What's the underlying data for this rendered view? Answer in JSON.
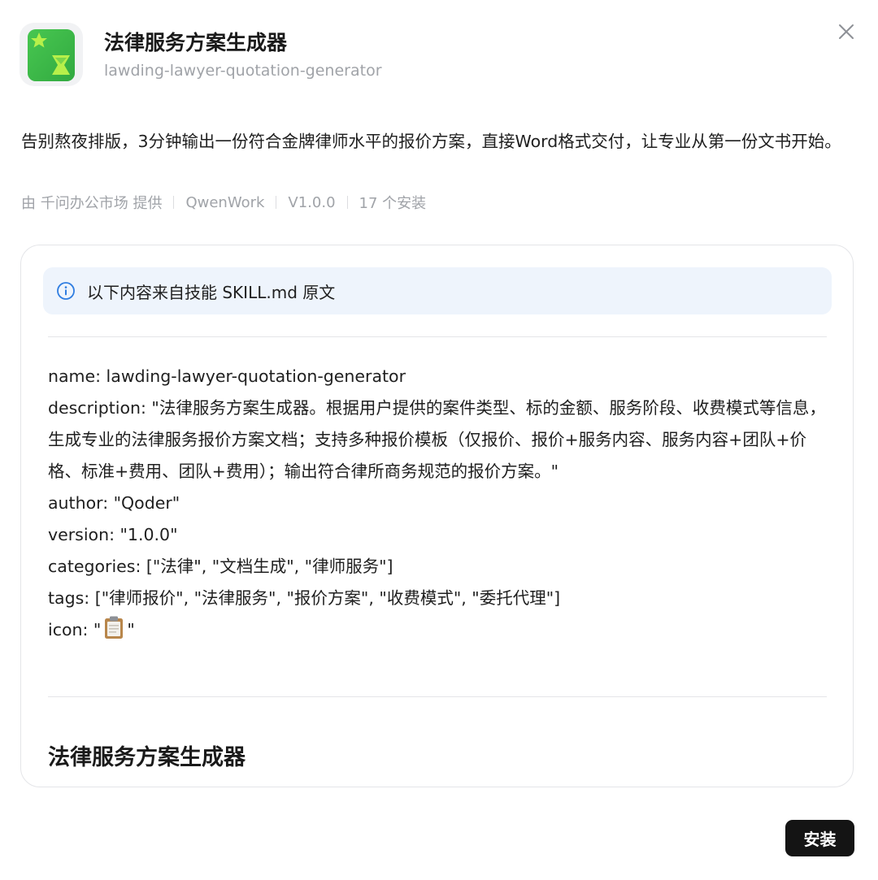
{
  "app": {
    "title": "法律服务方案生成器",
    "slug": "lawding-lawyer-quotation-generator",
    "icon": "app-icon-green-hourglass-star"
  },
  "summary": "告别熬夜排版，3分钟输出一份符合金牌律师水平的报价方案，直接Word格式交付，让专业从第一份文书开始。",
  "meta": {
    "provider": "由 千问办公市场 提供",
    "platform": "QwenWork",
    "version": "V1.0.0",
    "installs": "17 个安装"
  },
  "banner": {
    "icon": "info-icon",
    "text": "以下内容来自技能 SKILL.md 原文"
  },
  "frontmatter": {
    "name": "name: lawding-lawyer-quotation-generator",
    "description": "description: \"法律服务方案生成器。根据用户提供的案件类型、标的金额、服务阶段、收费模式等信息，生成专业的法律服务报价方案文档；支持多种报价模板（仅报价、报价+服务内容、服务内容+团队+价格、标准+费用、团队+费用）；输出符合律所商务规范的报价方案。\"",
    "author": "author: \"Qoder\"",
    "version": "version: \"1.0.0\"",
    "categories": "categories: [\"法律\", \"文档生成\", \"律师服务\"]",
    "tags": "tags: [\"律师报价\", \"法律服务\", \"报价方案\", \"收费模式\", \"委托代理\"]",
    "icon_prefix": "icon: \"",
    "icon_suffix": "\"",
    "icon_emoji": "clipboard-icon"
  },
  "section_heading": "法律服务方案生成器",
  "actions": {
    "install_label": "安装",
    "close_icon": "close-icon"
  },
  "colors": {
    "brand_green": "#3dbb4a",
    "accent_lime": "#b7f04a",
    "info_blue": "#2f7de1",
    "banner_bg": "#eef4fc",
    "button_bg": "#141414"
  }
}
